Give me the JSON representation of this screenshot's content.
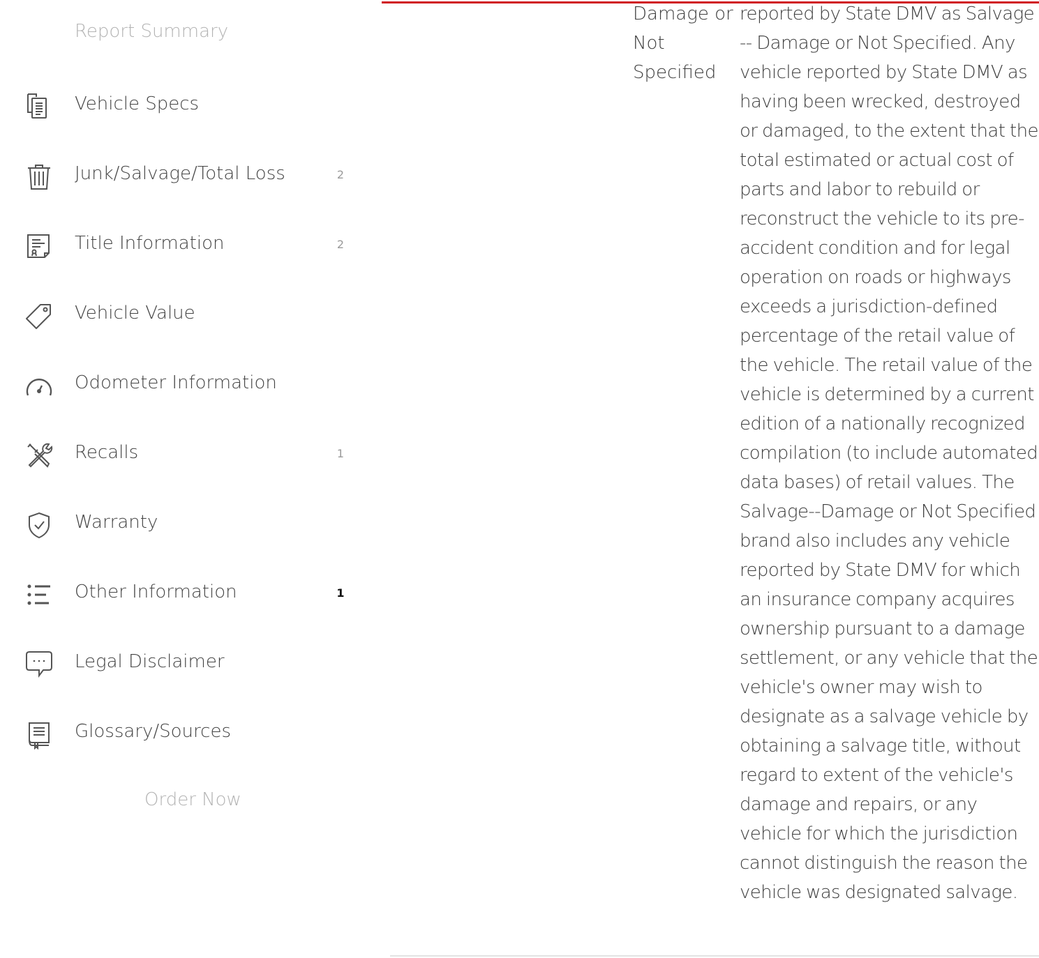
{
  "sidebar": {
    "report_summary": "Report Summary",
    "items": [
      {
        "label": "Vehicle Specs",
        "icon": "vehicle-specs-icon",
        "count": ""
      },
      {
        "label": "Junk/Salvage/Total Loss",
        "icon": "trash-icon",
        "count": "2"
      },
      {
        "label": "Title Information",
        "icon": "title-document-icon",
        "count": "2"
      },
      {
        "label": "Vehicle Value",
        "icon": "price-tag-icon",
        "count": ""
      },
      {
        "label": "Odometer Information",
        "icon": "odometer-icon",
        "count": ""
      },
      {
        "label": "Recalls",
        "icon": "tools-icon",
        "count": "1"
      },
      {
        "label": "Warranty",
        "icon": "shield-check-icon",
        "count": ""
      },
      {
        "label": "Other Information",
        "icon": "list-icon",
        "count": "1"
      },
      {
        "label": "Legal Disclaimer",
        "icon": "speech-bubble-icon",
        "count": ""
      },
      {
        "label": "Glossary/Sources",
        "icon": "book-icon",
        "count": ""
      }
    ],
    "order_now": "Order Now"
  },
  "colors": {
    "accent": "#d0121b",
    "text": "#3d3d3d",
    "muted": "#b3b3b3"
  },
  "glossary": {
    "term": "Damage or Not Specified",
    "definition": "reported by State DMV as Salvage -- Damage or Not Specified. Any vehicle reported by State DMV as having been wrecked, destroyed or damaged, to the extent that the total estimated or actual cost of parts and labor to rebuild or reconstruct the vehicle to its pre-accident condition and for legal operation on roads or highways exceeds a jurisdiction-defined percentage of the retail value of the vehicle. The retail value of the vehicle is determined by a current edition of a nationally recognized compilation (to include automated data bases) of retail values. The Salvage--Damage or Not Specified brand also includes any vehicle reported by State DMV for which an insurance company acquires ownership pursuant to a damage settlement, or any vehicle that the vehicle's owner may wish to designate as a salvage vehicle by obtaining a salvage title, without regard to extent of the vehicle's damage and repairs, or any vehicle for which the jurisdiction cannot distinguish the reason the vehicle was designated salvage."
  }
}
